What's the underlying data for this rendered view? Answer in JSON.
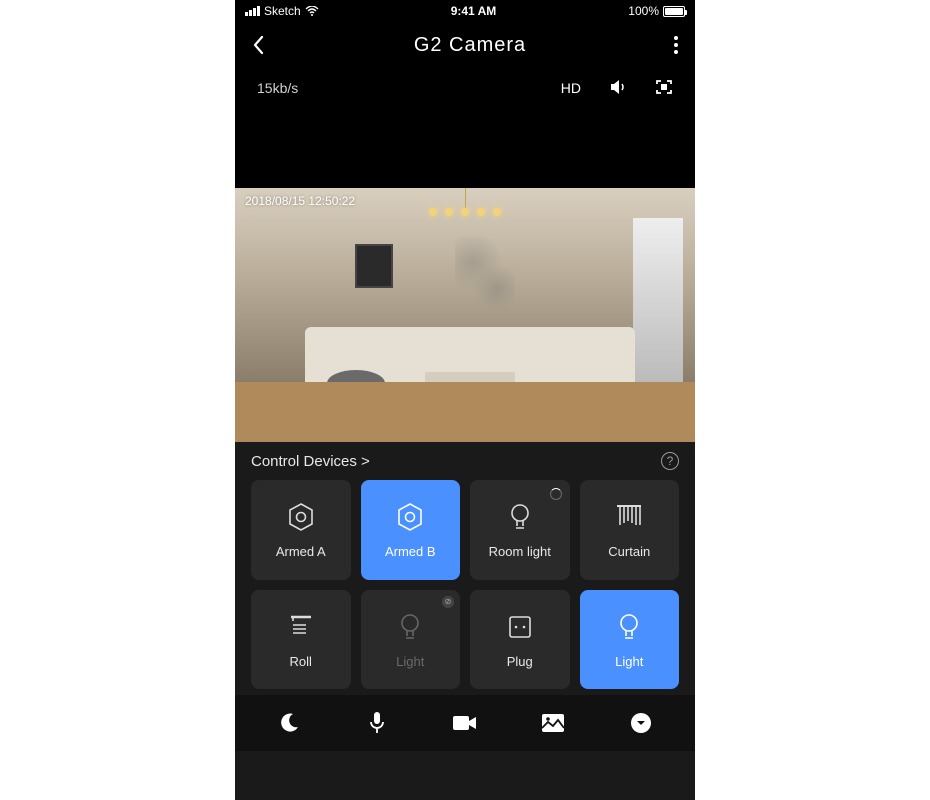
{
  "status": {
    "carrier": "Sketch",
    "time": "9:41 AM",
    "battery": "100%"
  },
  "nav": {
    "title": "G2 Camera"
  },
  "video": {
    "bitrate": "15kb/s",
    "quality": "HD",
    "timestamp": "2018/08/15 12:50:22"
  },
  "section": {
    "header": "Control Devices >"
  },
  "tiles": {
    "armed_a": "Armed A",
    "armed_b": "Armed B",
    "room_light": "Room light",
    "curtain": "Curtain",
    "roll": "Roll",
    "light_disabled": "Light",
    "plug": "Plug",
    "light_active": "Light"
  }
}
